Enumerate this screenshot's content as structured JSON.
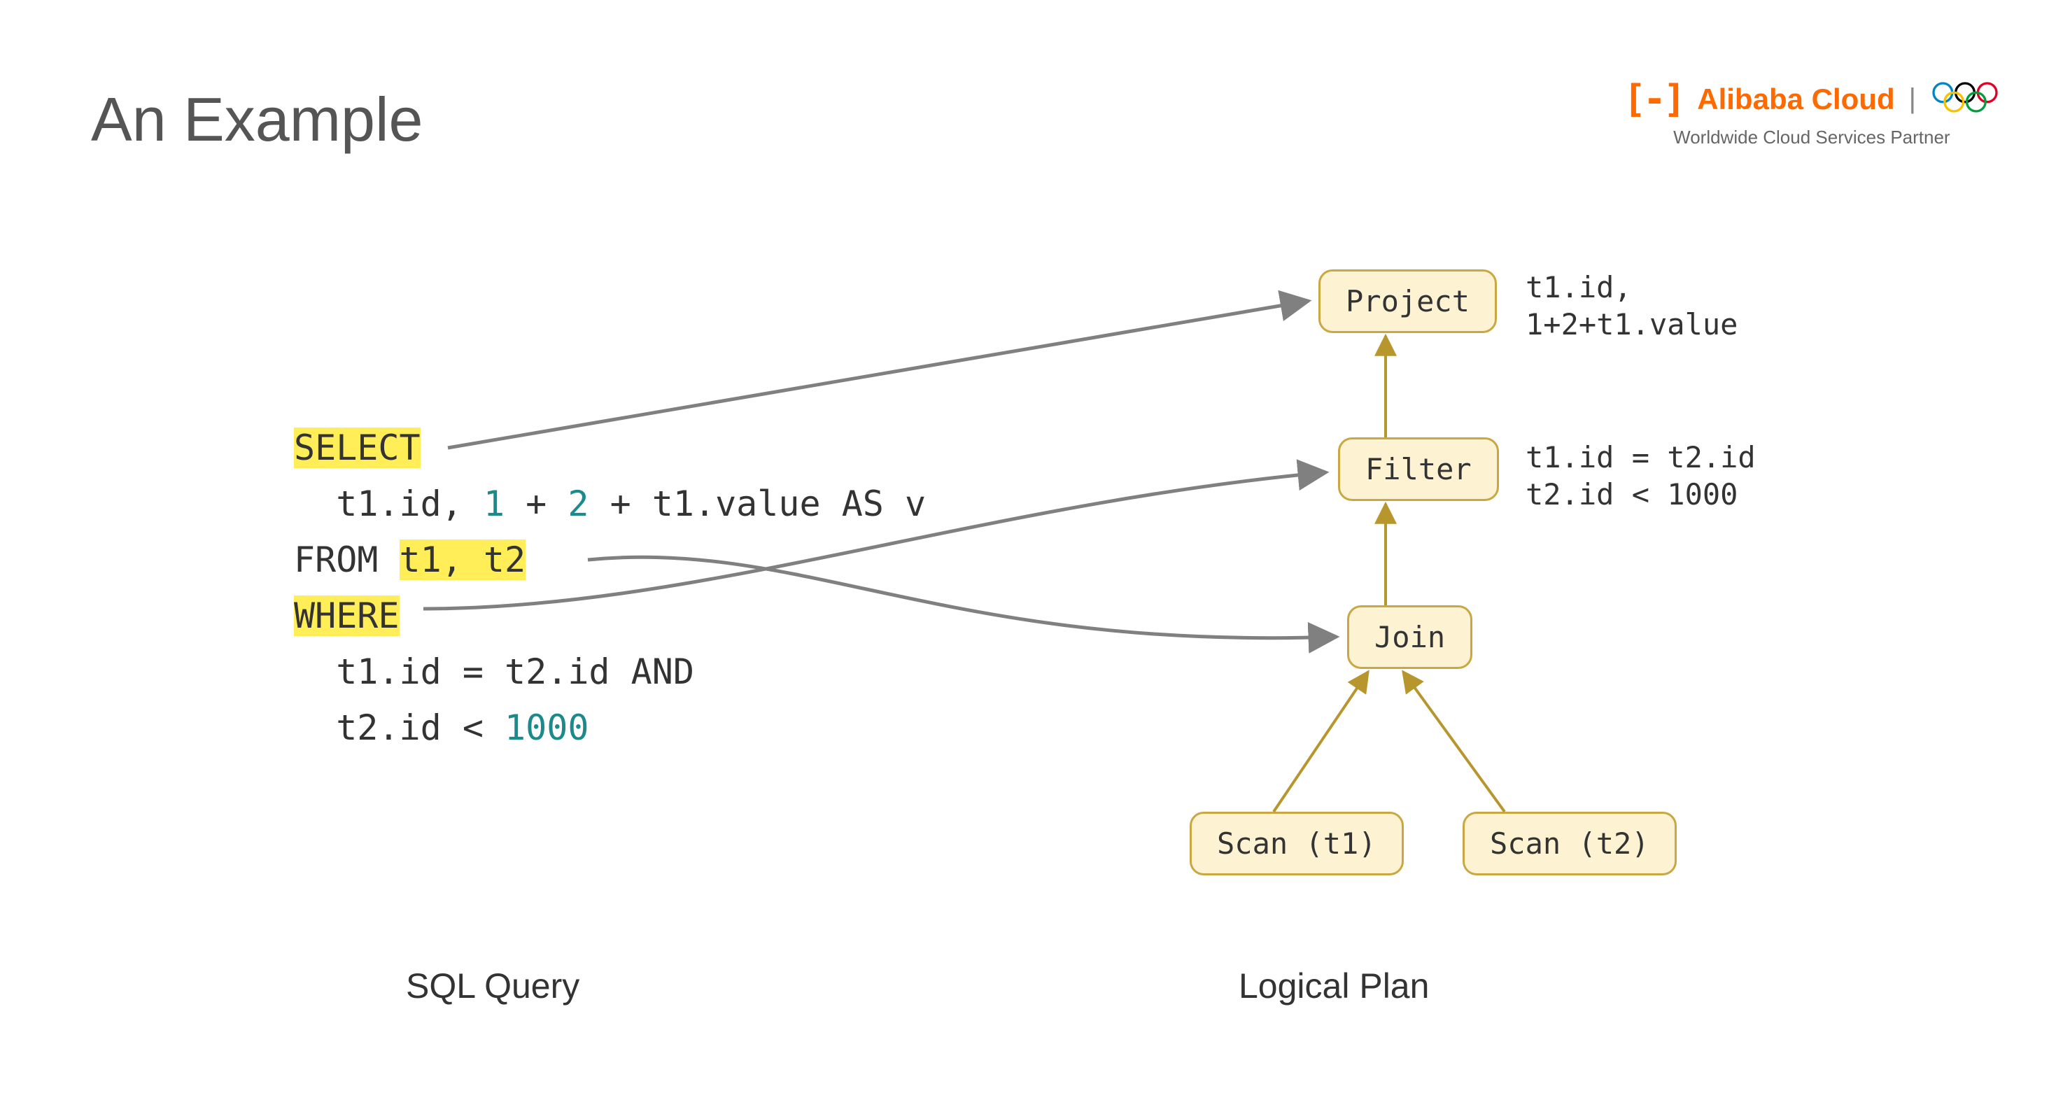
{
  "slide": {
    "title": "An Example",
    "label_left": "SQL Query",
    "label_right": "Logical Plan"
  },
  "logo": {
    "brackets": "[-]",
    "brand": "Alibaba Cloud",
    "separator": "|",
    "tagline": "Worldwide Cloud Services Partner"
  },
  "sql": {
    "select_kw": "SELECT",
    "select_indent": "  ",
    "select_expr_p1": "t1.id, ",
    "num1": "1",
    "plus1": " + ",
    "num2": "2",
    "select_expr_p2": " + t1.value AS v",
    "from_kw": "FROM ",
    "from_tables": "t1, t2",
    "where_kw": "WHERE",
    "where_l1": "  t1.id = t2.id AND",
    "where_l2_pre": "  t2.id < ",
    "where_l2_num": "1000"
  },
  "plan": {
    "project": {
      "label": "Project",
      "annot": "t1.id,\n1+2+t1.value"
    },
    "filter": {
      "label": "Filter",
      "annot": "t1.id = t2.id\nt2.id < 1000"
    },
    "join": {
      "label": "Join"
    },
    "scan_t1": {
      "label": "Scan (t1)"
    },
    "scan_t2": {
      "label": "Scan (t2)"
    }
  }
}
